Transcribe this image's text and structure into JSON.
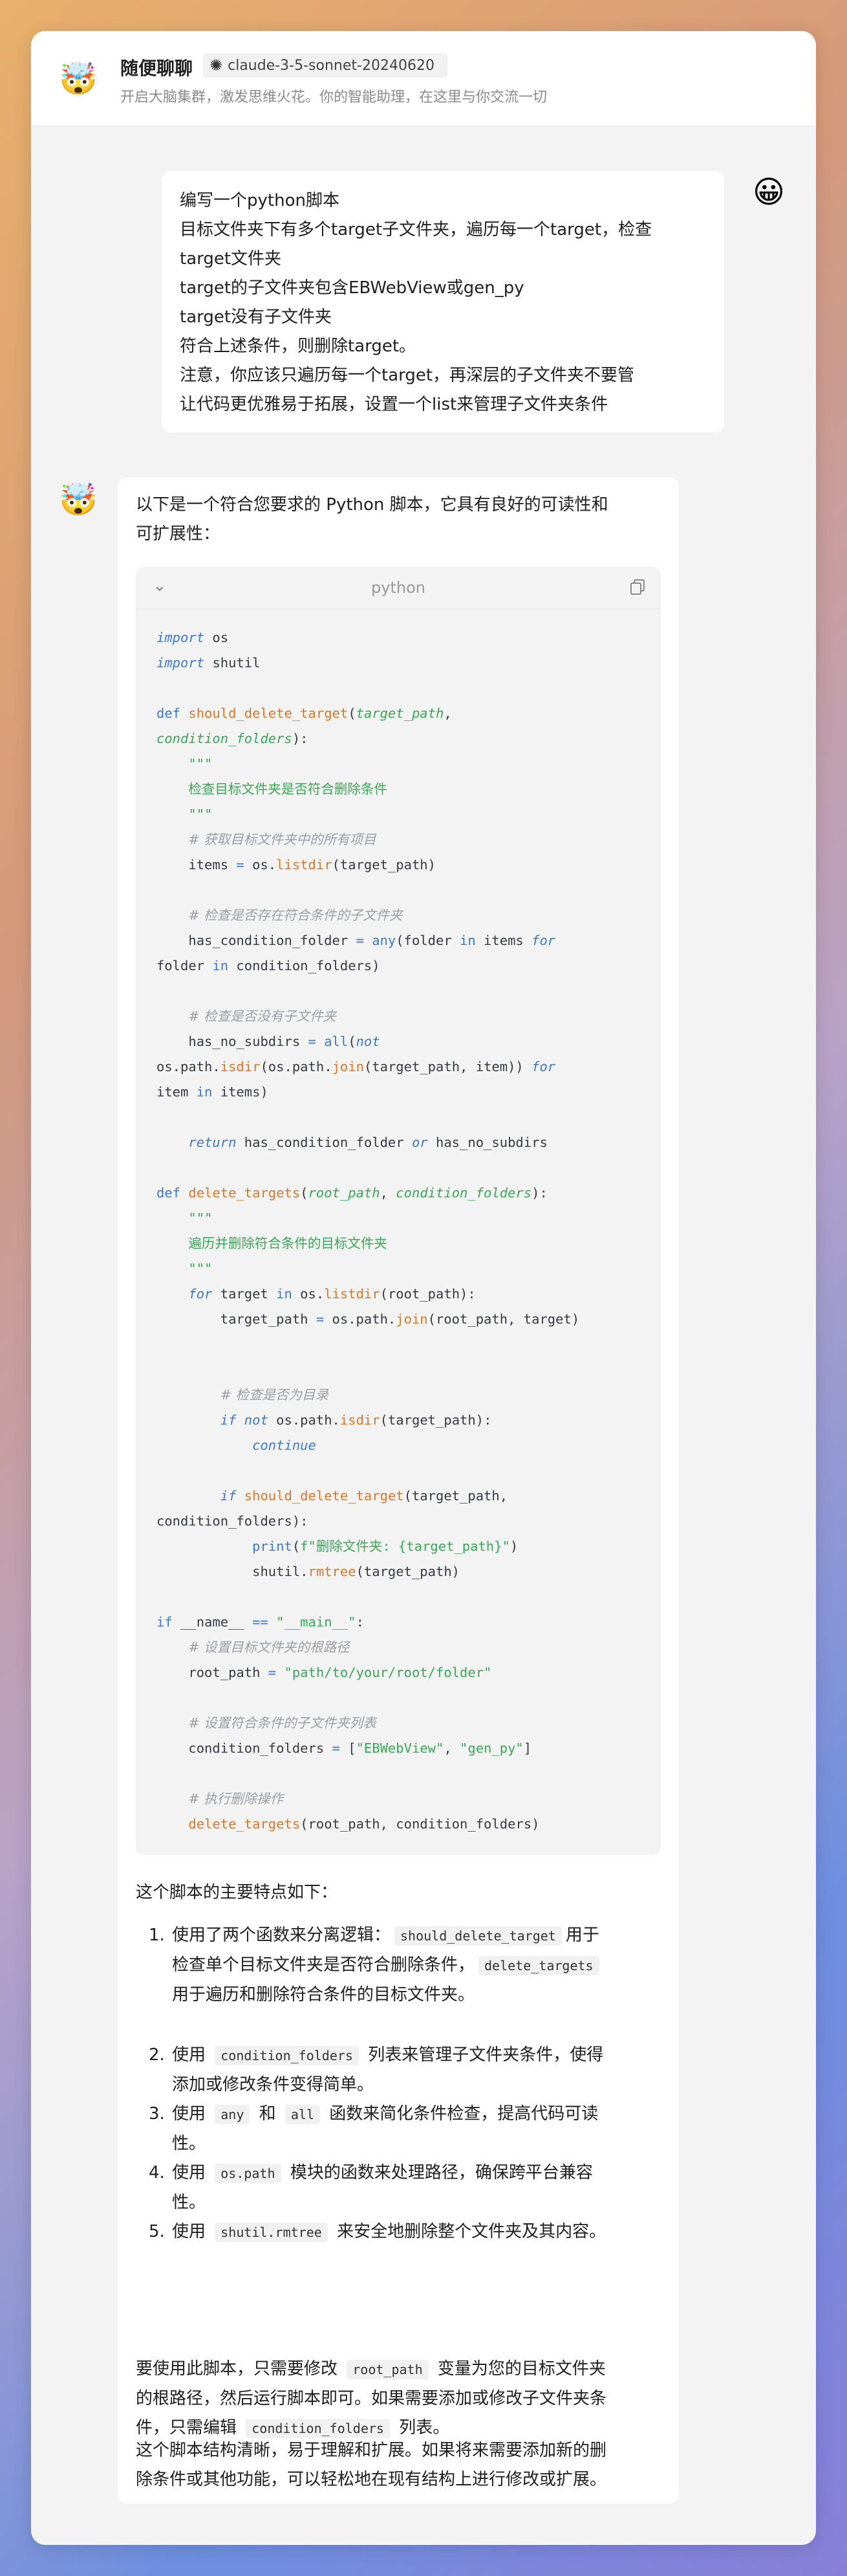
{
  "header": {
    "title": "随便聊聊",
    "model": "claude-3-5-sonnet-20240620",
    "subtitle": "开启大脑集群，激发思维火花。你的智能助理，在这里与你交流一切",
    "bot_avatar_icon": "🤯",
    "model_icon": "spark-icon"
  },
  "user_message": {
    "avatar_icon": "😀",
    "lines": [
      "编写一个python脚本",
      "目标文件夹下有多个target子文件夹，遍历每一个target，检查",
      "target文件夹",
      "target的子文件夹包含EBWebView或gen_py",
      "target没有子文件夹",
      "符合上述条件，则删除target。",
      "注意，你应该只遍历每一个target，再深层的子文件夹不要管",
      "让代码更优雅易于拓展，设置一个list来管理子文件夹条件"
    ]
  },
  "bot_message": {
    "avatar_icon": "🤯",
    "intro_lines": [
      "以下是一个符合您要求的 Python 脚本，它具有良好的可读性和",
      "可扩展性："
    ],
    "code": {
      "language": "python",
      "lines": [
        [
          [
            "kwi",
            "import"
          ],
          [
            "pl",
            " os"
          ]
        ],
        [
          [
            "kwi",
            "import"
          ],
          [
            "pl",
            " shutil"
          ]
        ],
        [],
        [
          [
            "kw",
            "def "
          ],
          [
            "fn",
            "should_delete_target"
          ],
          [
            "pl",
            "("
          ],
          [
            "param",
            "target_path"
          ],
          [
            "pl",
            ","
          ]
        ],
        [
          [
            "param",
            "condition_folders"
          ],
          [
            "pl",
            "):"
          ]
        ],
        [
          [
            "pl",
            "    "
          ],
          [
            "str",
            "\"\"\""
          ]
        ],
        [
          [
            "pl",
            "    "
          ],
          [
            "doc",
            "检查目标文件夹是否符合删除条件"
          ]
        ],
        [
          [
            "pl",
            "    "
          ],
          [
            "str",
            "\"\"\""
          ]
        ],
        [
          [
            "pl",
            "    "
          ],
          [
            "cm",
            "# 获取目标文件夹中的所有项目"
          ]
        ],
        [
          [
            "pl",
            "    items "
          ],
          [
            "op",
            "="
          ],
          [
            "pl",
            " os."
          ],
          [
            "fn",
            "listdir"
          ],
          [
            "pl",
            "(target_path)"
          ]
        ],
        [],
        [
          [
            "pl",
            "    "
          ],
          [
            "cm",
            "# 检查是否存在符合条件的子文件夹"
          ]
        ],
        [
          [
            "pl",
            "    has_condition_folder "
          ],
          [
            "op",
            "="
          ],
          [
            "pl",
            " "
          ],
          [
            "bi",
            "any"
          ],
          [
            "pl",
            "(folder "
          ],
          [
            "kw",
            "in"
          ],
          [
            "pl",
            " items "
          ],
          [
            "kwi",
            "for"
          ]
        ],
        [
          [
            "pl",
            "folder "
          ],
          [
            "kw",
            "in"
          ],
          [
            "pl",
            " condition_folders)"
          ]
        ],
        [],
        [
          [
            "pl",
            "    "
          ],
          [
            "cm",
            "# 检查是否没有子文件夹"
          ]
        ],
        [
          [
            "pl",
            "    has_no_subdirs "
          ],
          [
            "op",
            "="
          ],
          [
            "pl",
            " "
          ],
          [
            "bi",
            "all"
          ],
          [
            "pl",
            "("
          ],
          [
            "kwi",
            "not"
          ]
        ],
        [
          [
            "pl",
            "os.path."
          ],
          [
            "fn",
            "isdir"
          ],
          [
            "pl",
            "(os.path."
          ],
          [
            "fn",
            "join"
          ],
          [
            "pl",
            "(target_path, item)) "
          ],
          [
            "kwi",
            "for"
          ]
        ],
        [
          [
            "pl",
            "item "
          ],
          [
            "kw",
            "in"
          ],
          [
            "pl",
            " items)"
          ]
        ],
        [],
        [
          [
            "pl",
            "    "
          ],
          [
            "kwi",
            "return"
          ],
          [
            "pl",
            " has_condition_folder "
          ],
          [
            "kwi",
            "or"
          ],
          [
            "pl",
            " has_no_subdirs"
          ]
        ],
        [],
        [
          [
            "kw",
            "def "
          ],
          [
            "fn",
            "delete_targets"
          ],
          [
            "pl",
            "("
          ],
          [
            "param",
            "root_path"
          ],
          [
            "pl",
            ", "
          ],
          [
            "param",
            "condition_folders"
          ],
          [
            "pl",
            "):"
          ]
        ],
        [
          [
            "pl",
            "    "
          ],
          [
            "str",
            "\"\"\""
          ]
        ],
        [
          [
            "pl",
            "    "
          ],
          [
            "doc",
            "遍历并删除符合条件的目标文件夹"
          ]
        ],
        [
          [
            "pl",
            "    "
          ],
          [
            "str",
            "\"\"\""
          ]
        ],
        [
          [
            "pl",
            "    "
          ],
          [
            "kwi",
            "for"
          ],
          [
            "pl",
            " target "
          ],
          [
            "kw",
            "in"
          ],
          [
            "pl",
            " os."
          ],
          [
            "fn",
            "listdir"
          ],
          [
            "pl",
            "(root_path):"
          ]
        ],
        [
          [
            "pl",
            "        target_path "
          ],
          [
            "op",
            "="
          ],
          [
            "pl",
            " os.path."
          ],
          [
            "fn",
            "join"
          ],
          [
            "pl",
            "(root_path, target)"
          ]
        ],
        [],
        [],
        [
          [
            "pl",
            "        "
          ],
          [
            "cm",
            "# 检查是否为目录"
          ]
        ],
        [
          [
            "pl",
            "        "
          ],
          [
            "kwi",
            "if"
          ],
          [
            "pl",
            " "
          ],
          [
            "kwi",
            "not"
          ],
          [
            "pl",
            " os.path."
          ],
          [
            "fn",
            "isdir"
          ],
          [
            "pl",
            "(target_path):"
          ]
        ],
        [
          [
            "pl",
            "            "
          ],
          [
            "kwi",
            "continue"
          ]
        ],
        [],
        [
          [
            "pl",
            "        "
          ],
          [
            "kwi",
            "if"
          ],
          [
            "pl",
            " "
          ],
          [
            "fn",
            "should_delete_target"
          ],
          [
            "pl",
            "(target_path,"
          ]
        ],
        [
          [
            "pl",
            "condition_folders):"
          ]
        ],
        [
          [
            "pl",
            "            "
          ],
          [
            "bi",
            "print"
          ],
          [
            "pl",
            "("
          ],
          [
            "fstr",
            "f\"删除文件夹: {target_path}\""
          ],
          [
            "pl",
            ")"
          ]
        ],
        [
          [
            "pl",
            "            shutil."
          ],
          [
            "fn",
            "rmtree"
          ],
          [
            "pl",
            "(target_path)"
          ]
        ],
        [],
        [
          [
            "kw",
            "if"
          ],
          [
            "pl",
            " __name__ "
          ],
          [
            "op",
            "=="
          ],
          [
            "pl",
            " "
          ],
          [
            "str",
            "\"__main__\""
          ],
          [
            "pl",
            ":"
          ]
        ],
        [
          [
            "pl",
            "    "
          ],
          [
            "cm",
            "# 设置目标文件夹的根路径"
          ]
        ],
        [
          [
            "pl",
            "    root_path "
          ],
          [
            "op",
            "="
          ],
          [
            "pl",
            " "
          ],
          [
            "str",
            "\"path/to/your/root/folder\""
          ]
        ],
        [],
        [
          [
            "pl",
            "    "
          ],
          [
            "cm",
            "# 设置符合条件的子文件夹列表"
          ]
        ],
        [
          [
            "pl",
            "    condition_folders "
          ],
          [
            "op",
            "="
          ],
          [
            "pl",
            " ["
          ],
          [
            "str",
            "\"EBWebView\""
          ],
          [
            "pl",
            ", "
          ],
          [
            "str",
            "\"gen_py\""
          ],
          [
            "pl",
            "]"
          ]
        ],
        [],
        [
          [
            "pl",
            "    "
          ],
          [
            "cm",
            "# 执行删除操作"
          ]
        ],
        [
          [
            "pl",
            "    "
          ],
          [
            "fn",
            "delete_targets"
          ],
          [
            "pl",
            "(root_path, condition_folders)"
          ]
        ]
      ]
    },
    "features_title": "这个脚本的主要特点如下：",
    "features": [
      {
        "num": "1.",
        "gap_after": true,
        "lines": [
          [
            [
              "t",
              "使用了两个函数来分离逻辑："
            ],
            [
              "c",
              "should_delete_target"
            ],
            [
              "t",
              "用于"
            ]
          ],
          [
            [
              "t",
              "检查单个目标文件夹是否符合删除条件，"
            ],
            [
              "c",
              "delete_targets"
            ]
          ],
          [
            [
              "t",
              "用于遍历和删除符合条件的目标文件夹。"
            ]
          ]
        ]
      },
      {
        "num": "2.",
        "lines": [
          [
            [
              "t",
              "使用 "
            ],
            [
              "c",
              "condition_folders"
            ],
            [
              "t",
              " 列表来管理子文件夹条件，使得"
            ]
          ],
          [
            [
              "t",
              "添加或修改条件变得简单。"
            ]
          ]
        ]
      },
      {
        "num": "3.",
        "lines": [
          [
            [
              "t",
              "使用 "
            ],
            [
              "c",
              "any"
            ],
            [
              "t",
              " 和 "
            ],
            [
              "c",
              "all"
            ],
            [
              "t",
              " 函数来简化条件检查，提高代码可读"
            ]
          ],
          [
            [
              "t",
              "性。"
            ]
          ]
        ]
      },
      {
        "num": "4.",
        "lines": [
          [
            [
              "t",
              "使用 "
            ],
            [
              "c",
              "os.path"
            ],
            [
              "t",
              " 模块的函数来处理路径，确保跨平台兼容"
            ]
          ],
          [
            [
              "t",
              "性。"
            ]
          ]
        ]
      },
      {
        "num": "5.",
        "lines": [
          [
            [
              "t",
              "使用 "
            ],
            [
              "c",
              "shutil.rmtree"
            ],
            [
              "t",
              " 来安全地删除整个文件夹及其内容。"
            ]
          ]
        ]
      }
    ],
    "usage_lines": [
      [
        [
          "t",
          "要使用此脚本，只需要修改 "
        ],
        [
          "c",
          "root_path"
        ],
        [
          "t",
          " 变量为您的目标文件夹"
        ]
      ],
      [
        [
          "t",
          "的根路径，然后运行脚本即可。如果需要添加或修改子文件夹条"
        ]
      ],
      [
        [
          "t",
          "件，只需编辑 "
        ],
        [
          "c",
          "condition_folders"
        ],
        [
          "t",
          " 列表。"
        ]
      ]
    ],
    "closing_lines": [
      "这个脚本结构清晰，易于理解和扩展。如果将来需要添加新的删",
      "除条件或其他功能，可以轻松地在现有结构上进行修改或扩展。"
    ]
  }
}
